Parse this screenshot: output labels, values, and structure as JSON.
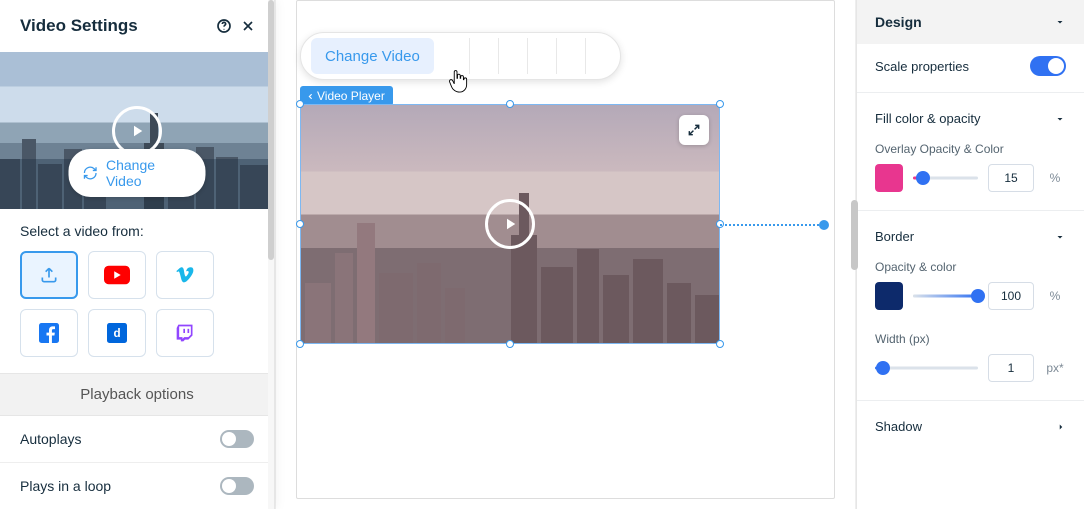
{
  "leftPanel": {
    "title": "Video Settings",
    "changeVideoBtn": "Change Video",
    "selectLabel": "Select a video from:",
    "sources": [
      {
        "name": "upload-icon"
      },
      {
        "name": "youtube-icon"
      },
      {
        "name": "vimeo-icon"
      },
      {
        "name": "facebook-icon"
      },
      {
        "name": "dailymotion-icon"
      },
      {
        "name": "twitch-icon"
      }
    ],
    "playbackHeader": "Playback options",
    "options": [
      {
        "label": "Autoplays",
        "on": false
      },
      {
        "label": "Plays in a loop",
        "on": false
      }
    ]
  },
  "toolbar": {
    "changeVideo": "Change Video"
  },
  "selectionBadge": "Video Player",
  "rightPanel": {
    "header": "Design",
    "scaleProps": "Scale properties",
    "fillColor": "Fill color & opacity",
    "overlayLabel": "Overlay Opacity & Color",
    "overlayValue": "15",
    "overlayUnit": "%",
    "overlayColor": "#e8368f",
    "overlaySliderPct": 15,
    "border": "Border",
    "opColorLabel": "Opacity & color",
    "opColorValue": "100",
    "opColorUnit": "%",
    "opColor": "#0d2a6b",
    "opSliderPct": 100,
    "widthLabel": "Width (px)",
    "widthValue": "1",
    "widthUnit": "px*",
    "widthSliderPct": 8,
    "shadow": "Shadow"
  }
}
